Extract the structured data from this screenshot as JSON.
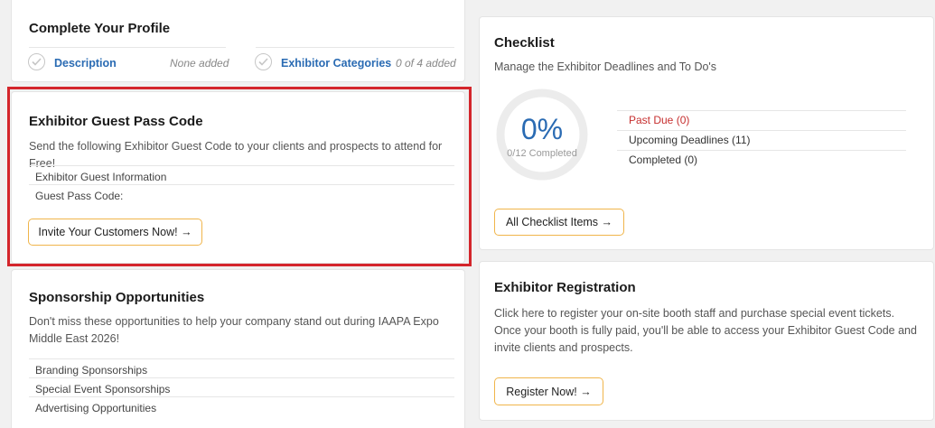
{
  "profile": {
    "title": "Complete Your Profile",
    "items": [
      {
        "label": "Description",
        "status": "None added"
      },
      {
        "label": "Exhibitor Categories",
        "status": "0 of 4 added"
      }
    ]
  },
  "guest_pass": {
    "title": "Exhibitor Guest Pass Code",
    "description": "Send the following Exhibitor Guest Code to your clients and prospects to attend for Free!",
    "rows": [
      "Exhibitor Guest Information",
      "Guest Pass Code:"
    ],
    "button": "Invite Your Customers Now! →"
  },
  "sponsorship": {
    "title": "Sponsorship Opportunities",
    "description": "Don't miss these opportunities to help your company stand out during IAAPA Expo Middle East 2026!",
    "rows": [
      "Branding Sponsorships",
      "Special Event Sponsorships",
      "Advertising Opportunities"
    ]
  },
  "checklist": {
    "title": "Checklist",
    "description": "Manage the Exhibitor Deadlines and To Do's",
    "percent": "0%",
    "progress_fraction": 0,
    "completed_text": "0/12 Completed",
    "statuses": [
      "Past Due (0)",
      "Upcoming Deadlines (11)",
      "Completed (0)"
    ],
    "button": "All Checklist Items →"
  },
  "registration": {
    "title": "Exhibitor Registration",
    "description": "Click here to register your on-site booth staff and purchase special event tickets. Once your booth is fully paid, you'll be able to access your Exhibitor Guest Code and invite clients and prospects.",
    "button": "Register Now! →"
  },
  "colors": {
    "accent_border": "#f0b54b",
    "link": "#2a6bb3",
    "past_due": "#c62f2f",
    "highlight": "#d4262c"
  }
}
